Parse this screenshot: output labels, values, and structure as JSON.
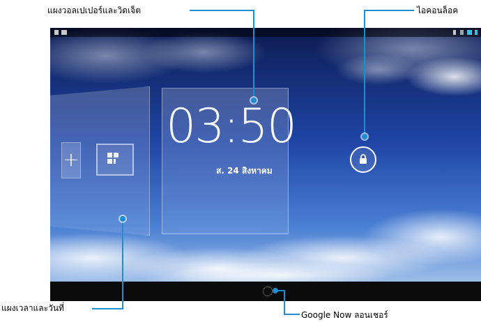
{
  "callouts": {
    "wallpaper_widget": "แผงวอลเปเปอร์และวิดเจ็ต",
    "lock_icon": "ไอคอนล็อค",
    "time_date": "แผงเวลาและวันที่",
    "google_now": "Google Now ลอนเชอร์"
  },
  "lockscreen": {
    "time": "03:50",
    "date": "ส. 24 สิงหาคม",
    "add_label": "+"
  },
  "icons": [
    "lock-icon",
    "add-widget-icon",
    "widget-grid-icon",
    "google-now-launcher-icon",
    "wifi-icon",
    "battery-icon",
    "bluetooth-icon"
  ],
  "colors": {
    "callout_line": "#1d8fd1",
    "sky_top": "#0c1a4a",
    "sky_mid": "#2f59b5",
    "navbar": "#0b0b0b"
  }
}
